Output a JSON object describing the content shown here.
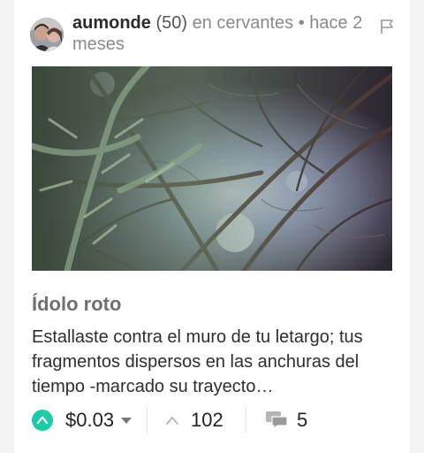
{
  "post": {
    "author": "aumonde",
    "reputation": "(50)",
    "community_prefix": "en cervantes",
    "separator": "•",
    "time": "hace 2 meses",
    "title": "Ídolo roto",
    "excerpt": "Estallaste contra el muro de tu letargo; tus fragmentos dispersos en las anchuras del tiempo -marcado su trayecto…"
  },
  "footer": {
    "payout": "$0.03",
    "votes": "102",
    "comments": "5"
  },
  "colors": {
    "accent": "#1fcaa7",
    "text": "#222222",
    "muted": "#8a8a8a"
  },
  "icons": [
    "flag-icon",
    "upvote-icon",
    "caret-down-icon",
    "chevron-up-icon",
    "comments-icon"
  ]
}
